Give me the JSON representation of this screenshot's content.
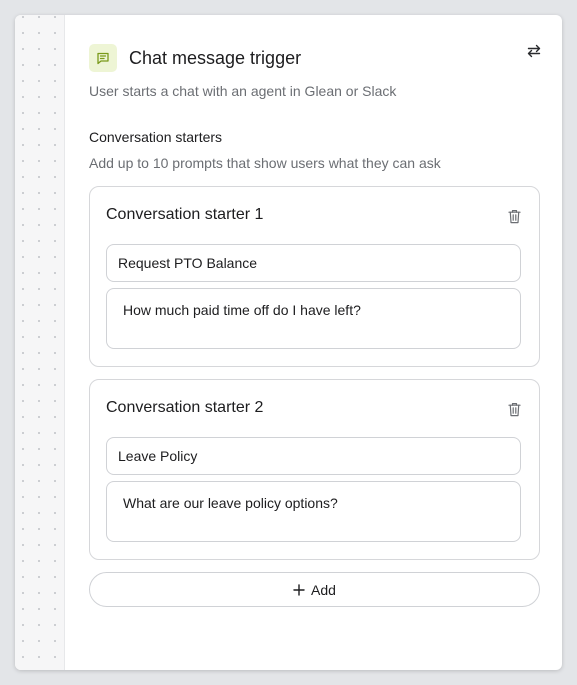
{
  "trigger": {
    "title": "Chat message trigger",
    "subtitle": "User starts a chat with an agent in Glean or Slack",
    "icon": "chat-bubble-icon",
    "icon_bg": "#eef5d5",
    "icon_color": "#7a9a1a"
  },
  "section": {
    "label": "Conversation starters",
    "help": "Add up to 10 prompts that show users what they can ask"
  },
  "starters": [
    {
      "heading": "Conversation starter 1",
      "title_value": "Request PTO Balance",
      "prompt_value": "How much paid time off do I have left?"
    },
    {
      "heading": "Conversation starter 2",
      "title_value": "Leave Policy",
      "prompt_value": "What are our leave policy options?"
    }
  ],
  "actions": {
    "add_label": "Add",
    "swap_icon": "swap-arrows-icon",
    "delete_icon": "trash-icon",
    "add_icon": "plus-icon"
  }
}
